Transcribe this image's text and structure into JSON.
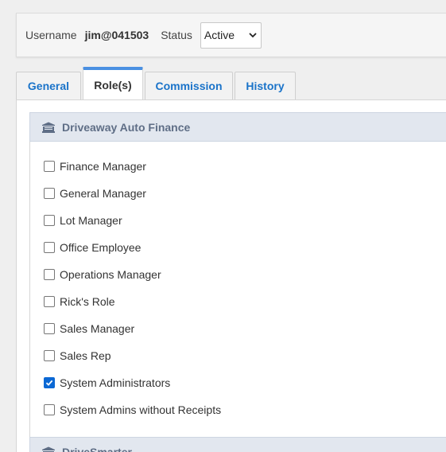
{
  "user": {
    "username_label": "Username",
    "username_value": "jim@041503",
    "status_label": "Status",
    "status_value": "Active"
  },
  "tabs": [
    {
      "label": "General",
      "active": false
    },
    {
      "label": "Role(s)",
      "active": true
    },
    {
      "label": "Commission",
      "active": false
    },
    {
      "label": "History",
      "active": false
    }
  ],
  "companies": [
    {
      "name": "Driveaway Auto Finance",
      "icon": "bank-icon",
      "roles": [
        {
          "label": "Finance Manager",
          "checked": false
        },
        {
          "label": "General Manager",
          "checked": false
        },
        {
          "label": "Lot Manager",
          "checked": false
        },
        {
          "label": "Office Employee",
          "checked": false
        },
        {
          "label": "Operations Manager",
          "checked": false
        },
        {
          "label": "Rick's Role",
          "checked": false
        },
        {
          "label": "Sales Manager",
          "checked": false
        },
        {
          "label": "Sales Rep",
          "checked": false
        },
        {
          "label": "System Administrators",
          "checked": true
        },
        {
          "label": "System Admins without Receipts",
          "checked": false
        }
      ]
    },
    {
      "name": "DriveSmarter",
      "icon": "bank-icon"
    }
  ],
  "colors": {
    "tab_link": "#1a73c9",
    "active_tab_accent": "#4a90e2",
    "header_bg": "#e2e7ef",
    "checkbox_checked": "#0b68d4"
  }
}
